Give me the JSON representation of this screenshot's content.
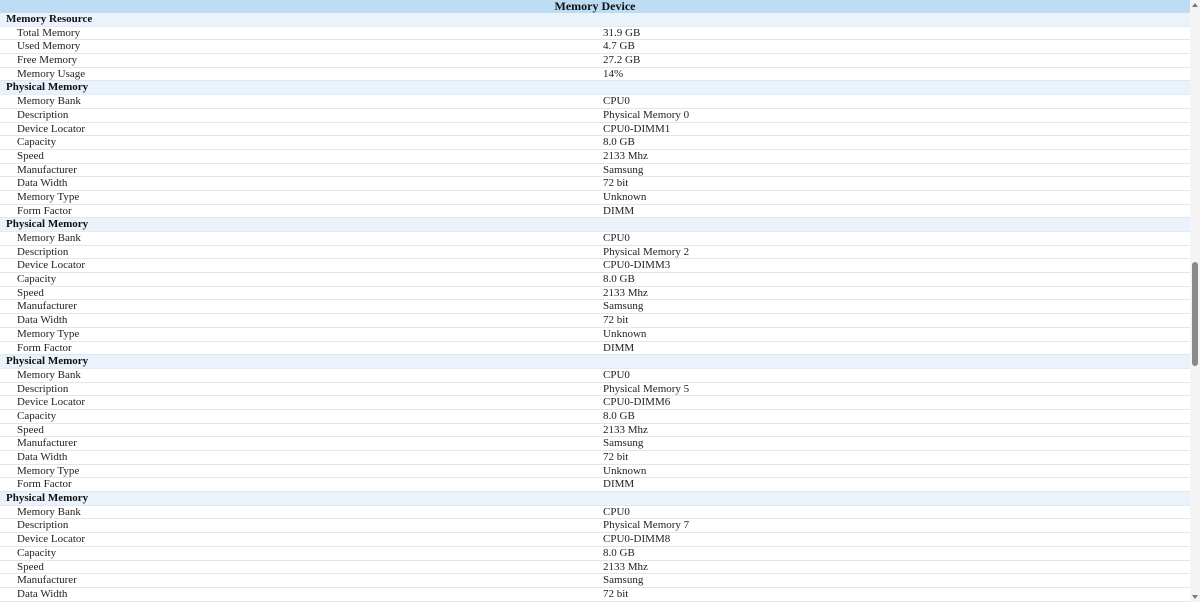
{
  "title": "Memory Device",
  "sections": [
    {
      "heading": "Memory Resource",
      "rows": [
        {
          "label": "Total Memory",
          "value": "31.9 GB"
        },
        {
          "label": "Used Memory",
          "value": "4.7 GB"
        },
        {
          "label": "Free Memory",
          "value": "27.2 GB"
        },
        {
          "label": "Memory Usage",
          "value": "14%"
        }
      ]
    },
    {
      "heading": "Physical Memory",
      "rows": [
        {
          "label": "Memory Bank",
          "value": "CPU0"
        },
        {
          "label": "Description",
          "value": "Physical Memory 0"
        },
        {
          "label": "Device Locator",
          "value": "CPU0-DIMM1"
        },
        {
          "label": "Capacity",
          "value": "8.0 GB"
        },
        {
          "label": "Speed",
          "value": "2133 Mhz"
        },
        {
          "label": "Manufacturer",
          "value": "Samsung"
        },
        {
          "label": "Data Width",
          "value": "72 bit"
        },
        {
          "label": "Memory Type",
          "value": "Unknown"
        },
        {
          "label": "Form Factor",
          "value": "DIMM"
        }
      ]
    },
    {
      "heading": "Physical Memory",
      "rows": [
        {
          "label": "Memory Bank",
          "value": "CPU0"
        },
        {
          "label": "Description",
          "value": "Physical Memory 2"
        },
        {
          "label": "Device Locator",
          "value": "CPU0-DIMM3"
        },
        {
          "label": "Capacity",
          "value": "8.0 GB"
        },
        {
          "label": "Speed",
          "value": "2133 Mhz"
        },
        {
          "label": "Manufacturer",
          "value": "Samsung"
        },
        {
          "label": "Data Width",
          "value": "72 bit"
        },
        {
          "label": "Memory Type",
          "value": "Unknown"
        },
        {
          "label": "Form Factor",
          "value": "DIMM"
        }
      ]
    },
    {
      "heading": "Physical Memory",
      "rows": [
        {
          "label": "Memory Bank",
          "value": "CPU0"
        },
        {
          "label": "Description",
          "value": "Physical Memory 5"
        },
        {
          "label": "Device Locator",
          "value": "CPU0-DIMM6"
        },
        {
          "label": "Capacity",
          "value": "8.0 GB"
        },
        {
          "label": "Speed",
          "value": "2133 Mhz"
        },
        {
          "label": "Manufacturer",
          "value": "Samsung"
        },
        {
          "label": "Data Width",
          "value": "72 bit"
        },
        {
          "label": "Memory Type",
          "value": "Unknown"
        },
        {
          "label": "Form Factor",
          "value": "DIMM"
        }
      ]
    },
    {
      "heading": "Physical Memory",
      "rows": [
        {
          "label": "Memory Bank",
          "value": "CPU0"
        },
        {
          "label": "Description",
          "value": "Physical Memory 7"
        },
        {
          "label": "Device Locator",
          "value": "CPU0-DIMM8"
        },
        {
          "label": "Capacity",
          "value": "8.0 GB"
        },
        {
          "label": "Speed",
          "value": "2133 Mhz"
        },
        {
          "label": "Manufacturer",
          "value": "Samsung"
        },
        {
          "label": "Data Width",
          "value": "72 bit"
        }
      ]
    }
  ]
}
